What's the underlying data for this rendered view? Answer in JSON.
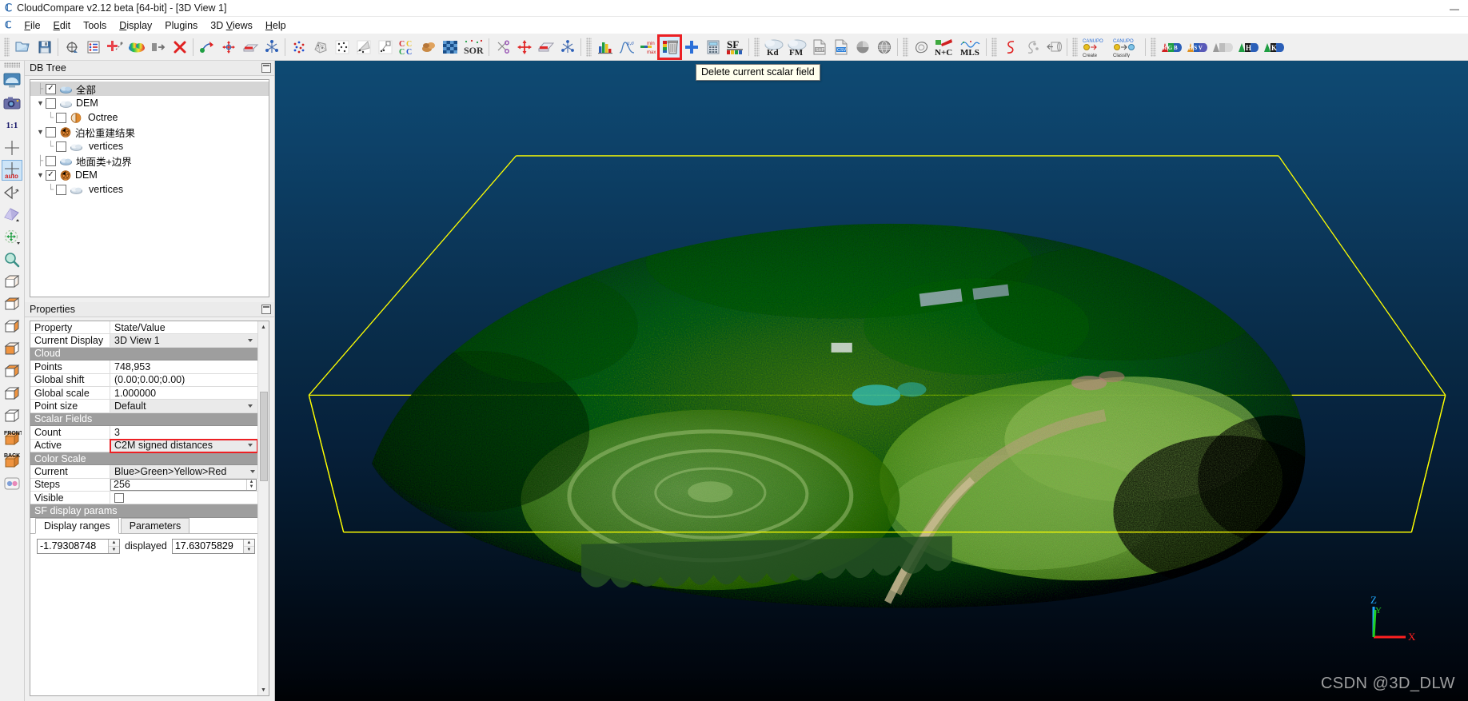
{
  "window": {
    "title": "CloudCompare v2.12 beta [64-bit] - [3D View 1]",
    "app_glyph": "ℂ",
    "minimize": "—",
    "maximize": "❐",
    "close": "✕"
  },
  "menubar": {
    "app_glyph": "ℂ",
    "items": [
      {
        "label": "File",
        "mnemonic": "F"
      },
      {
        "label": "Edit",
        "mnemonic": "E"
      },
      {
        "label": "Tools",
        "mnemonic": ""
      },
      {
        "label": "Display",
        "mnemonic": "D"
      },
      {
        "label": "Plugins",
        "mnemonic": ""
      },
      {
        "label": "3D Views",
        "mnemonic": "V"
      },
      {
        "label": "Help",
        "mnemonic": "H"
      }
    ]
  },
  "toolbar": {
    "tooltip": "Delete current scalar field",
    "highlighted_button": "delete-scalar-field-button",
    "groups": [
      {
        "name": "file-group",
        "buttons": [
          {
            "name": "open-file-button",
            "icon": "open-folder-icon",
            "title": "Open"
          },
          {
            "name": "save-file-button",
            "icon": "save-disk-icon",
            "title": "Save"
          }
        ]
      },
      {
        "name": "edit-group",
        "buttons": [
          {
            "name": "clone-button",
            "icon": "clone-icon",
            "title": "Clone"
          },
          {
            "name": "properties-button",
            "icon": "list-icon",
            "title": "Properties"
          },
          {
            "name": "merge-button",
            "icon": "merge-plus-icon",
            "title": "Merge"
          },
          {
            "name": "colors-button",
            "icon": "rainbow-cloud-icon",
            "title": "Colors"
          },
          {
            "name": "subsample-button",
            "icon": "arrow-into-box-icon",
            "title": "Subsample"
          },
          {
            "name": "delete-button",
            "icon": "red-x-icon",
            "title": "Delete"
          }
        ]
      },
      {
        "name": "transform-group",
        "buttons": [
          {
            "name": "align-button",
            "icon": "align-points-icon",
            "title": "Align"
          },
          {
            "name": "translate-rotate-button",
            "icon": "translate-rotate-icon",
            "title": "Translate/Rotate"
          },
          {
            "name": "segment-button",
            "icon": "segment-icon",
            "title": "Segment"
          }
        ]
      },
      {
        "name": "cloud-tools-group",
        "buttons": [
          {
            "name": "point-picking-button",
            "icon": "point-cloud-icon",
            "title": "Point picking"
          },
          {
            "name": "mesh-button",
            "icon": "mesh-icon",
            "title": "Mesh"
          },
          {
            "name": "sample-points-button",
            "icon": "sample-points-icon",
            "title": "Sample points"
          },
          {
            "name": "normals-button",
            "icon": "normals-icon",
            "title": "Compute normals"
          },
          {
            "name": "fit-button",
            "icon": "fit-plane-icon",
            "title": "Fit"
          },
          {
            "name": "cc-compare-button",
            "icon": "cc-icon",
            "title": "Cloud/Cloud dist"
          },
          {
            "name": "cm-compare-button",
            "icon": "cloud-mesh-icon",
            "title": "Cloud/Mesh dist"
          },
          {
            "name": "checker-button",
            "icon": "checkerboard-icon",
            "title": "Statistical test"
          },
          {
            "name": "sor-filter-button",
            "icon": "sor-icon",
            "title": "SOR filter"
          }
        ]
      },
      {
        "name": "scissors-group",
        "buttons": [
          {
            "name": "scissors-button",
            "icon": "scissors-icon",
            "title": "Cut"
          },
          {
            "name": "translate-gizmo-button",
            "icon": "move-arrows-icon",
            "title": "Translate"
          },
          {
            "name": "section-box-button",
            "icon": "clip-box-icon",
            "title": "Clipping box"
          },
          {
            "name": "registration-button",
            "icon": "registration-icon",
            "title": "Register"
          }
        ]
      },
      {
        "name": "scalar-field-group",
        "buttons": [
          {
            "name": "histogram-button",
            "icon": "bar-chart-icon",
            "title": "Histogram"
          },
          {
            "name": "gaussian-filter-button",
            "icon": "gaussian-curve-icon",
            "title": "Gaussian filter"
          },
          {
            "name": "min-max-button",
            "icon": "min-max-icon",
            "title": "Min/Max"
          },
          {
            "name": "delete-scalar-field-button",
            "icon": "delete-scalar-field-icon",
            "title": "Delete current scalar field"
          },
          {
            "name": "add-scalar-field-button",
            "icon": "blue-plus-icon",
            "title": "Add scalar field"
          },
          {
            "name": "calculator-button",
            "icon": "calculator-icon",
            "title": "SF arithmetic"
          },
          {
            "name": "sf-colors-button",
            "icon": "sf-icon",
            "title": "SF to colors"
          }
        ]
      },
      {
        "name": "interpolation-group",
        "buttons": [
          {
            "name": "kd-tree-button",
            "icon": "kd-cloud-icon",
            "title": "Kd"
          },
          {
            "name": "fm-button",
            "icon": "fm-cloud-icon",
            "title": "FM"
          },
          {
            "name": "shp-export-button",
            "icon": "shp-file-icon",
            "title": "SHP"
          },
          {
            "name": "csv-export-button",
            "icon": "csv-file-icon",
            "title": "CSV"
          },
          {
            "name": "pie-button",
            "icon": "pie-icon",
            "title": "Pie"
          },
          {
            "name": "globe-button",
            "icon": "globe-icon",
            "title": "Globe"
          }
        ]
      },
      {
        "name": "plugins-group",
        "buttons": [
          {
            "name": "poisson-button",
            "icon": "contour-icon",
            "title": "Poisson"
          },
          {
            "name": "nc-button",
            "icon": "n-plus-c-icon",
            "title": "N+C"
          },
          {
            "name": "mls-button",
            "icon": "mls-icon",
            "title": "MLS"
          }
        ]
      },
      {
        "name": "curve-group",
        "buttons": [
          {
            "name": "curve-s-button",
            "icon": "red-s-curve-icon",
            "title": "S"
          },
          {
            "name": "scatter-curve-button",
            "icon": "scatter-curve-icon",
            "title": "Scatter"
          },
          {
            "name": "extrude-button",
            "icon": "extrude-icon",
            "title": "Extrude"
          }
        ]
      },
      {
        "name": "canupo-group",
        "buttons": [
          {
            "name": "canupo-create-button",
            "icon": "canupo-create-icon",
            "title": "CANUPO Create"
          },
          {
            "name": "canupo-classify-button",
            "icon": "canupo-classify-icon",
            "title": "CANUPO Classify"
          }
        ]
      },
      {
        "name": "color-convert-group",
        "buttons": [
          {
            "name": "rgb-convert-button",
            "icon": "rgb-icon",
            "title": "RGB"
          },
          {
            "name": "hsv-convert-button",
            "icon": "hsv-icon",
            "title": "HSV"
          },
          {
            "name": "gray-convert-button",
            "icon": "gray-icon",
            "title": "Gray"
          },
          {
            "name": "h-convert-button",
            "icon": "h-icon",
            "title": "H"
          },
          {
            "name": "k-convert-button",
            "icon": "k-icon",
            "title": "K"
          }
        ]
      }
    ]
  },
  "left_toolbar": {
    "buttons": [
      {
        "name": "fullscreen-view-button",
        "icon": "monitor-icon",
        "active": false
      },
      {
        "name": "snapshot-button",
        "icon": "camera-icon",
        "active": false
      },
      {
        "name": "zoom-one-to-one-button",
        "icon": "one-to-one-icon",
        "label": "1:1",
        "active": false
      },
      {
        "name": "set-pivot-button",
        "icon": "crosshair-icon",
        "active": false
      },
      {
        "name": "auto-pivot-button",
        "icon": "crosshair-auto-icon",
        "label": "auto",
        "active": true
      },
      {
        "name": "toggle-perspective-button",
        "icon": "eye-perspective-icon",
        "active": false
      },
      {
        "name": "viewer-perspective-button",
        "icon": "plane-perspective-icon",
        "active": false
      },
      {
        "name": "object-rotate-button",
        "icon": "rotate-object-icon",
        "active": false
      },
      {
        "name": "zoom-tool-button",
        "icon": "magnifier-icon",
        "active": false
      },
      {
        "name": "global-zoom-button",
        "icon": "cube-wire-icon",
        "active": false
      },
      {
        "name": "top-view-button",
        "icon": "cube-top-icon",
        "active": false
      },
      {
        "name": "bottom-view-button",
        "icon": "cube-bottom-icon",
        "active": false
      },
      {
        "name": "left-view-button",
        "icon": "cube-left-icon",
        "active": false
      },
      {
        "name": "right-view-button",
        "icon": "cube-right-icon",
        "active": false
      },
      {
        "name": "iso1-view-button",
        "icon": "cube-iso1-icon",
        "active": false
      },
      {
        "name": "iso2-view-button",
        "icon": "cube-iso2-icon",
        "active": false
      },
      {
        "name": "front-view-button",
        "icon": "cube-front-icon",
        "label": "FRONT",
        "active": false
      },
      {
        "name": "back-view-button",
        "icon": "cube-back-icon",
        "label": "BACK",
        "active": false
      },
      {
        "name": "stereo-mode-button",
        "icon": "two-dots-icon",
        "active": false
      }
    ]
  },
  "db_tree": {
    "title": "DB Tree",
    "items": [
      {
        "label": "全部",
        "depth": 0,
        "arrow": "",
        "elbow": "├",
        "checked": true,
        "icon": "cloud-icon",
        "selected": true
      },
      {
        "label": "DEM",
        "depth": 0,
        "arrow": "▼",
        "elbow": "",
        "checked": false,
        "icon": "cloud-icon",
        "selected": false
      },
      {
        "label": "Octree",
        "depth": 1,
        "arrow": "",
        "elbow": "└",
        "checked": false,
        "icon": "octree-icon",
        "selected": false
      },
      {
        "label": "泊松重建结果",
        "depth": 0,
        "arrow": "▼",
        "elbow": "",
        "checked": false,
        "icon": "mesh-star-icon",
        "selected": false
      },
      {
        "label": "vertices",
        "depth": 1,
        "arrow": "",
        "elbow": "└",
        "checked": false,
        "icon": "cloud-icon",
        "selected": false
      },
      {
        "label": "地面类+边界",
        "depth": 0,
        "arrow": "",
        "elbow": "├",
        "checked": false,
        "icon": "cloud-icon",
        "selected": false
      },
      {
        "label": "DEM",
        "depth": 0,
        "arrow": "▼",
        "elbow": "",
        "checked": true,
        "icon": "mesh-star-icon",
        "selected": false
      },
      {
        "label": "vertices",
        "depth": 1,
        "arrow": "",
        "elbow": "└",
        "checked": false,
        "icon": "cloud-icon",
        "selected": false
      }
    ]
  },
  "properties": {
    "title": "Properties",
    "header": {
      "property": "Property",
      "state_value": "State/Value"
    },
    "rows": [
      {
        "key": "Current Display",
        "value": "3D View 1",
        "kind": "combo"
      },
      {
        "section": "Cloud"
      },
      {
        "key": "Points",
        "value": "748,953",
        "kind": "text"
      },
      {
        "key": "Global shift",
        "value": "(0.00;0.00;0.00)",
        "kind": "text"
      },
      {
        "key": "Global scale",
        "value": "1.000000",
        "kind": "text"
      },
      {
        "key": "Point size",
        "value": "Default",
        "kind": "combo"
      },
      {
        "section": "Scalar Fields"
      },
      {
        "key": "Count",
        "value": "3",
        "kind": "text"
      },
      {
        "key": "Active",
        "value": "C2M signed distances",
        "kind": "combo",
        "highlight": true
      },
      {
        "section": "Color Scale"
      },
      {
        "key": "Current",
        "value": "Blue>Green>Yellow>Red",
        "kind": "combo-ramp"
      },
      {
        "key": "Steps",
        "value": "256",
        "kind": "spin"
      },
      {
        "key": "Visible",
        "value": "",
        "kind": "checkbox",
        "checked": false
      },
      {
        "section": "SF display params"
      }
    ],
    "sf_tabs": [
      {
        "label": "Display ranges",
        "active": true
      },
      {
        "label": "Parameters",
        "active": false
      }
    ],
    "display_range": {
      "min": "-1.79308748",
      "label": "displayed",
      "max": "17.63075829"
    }
  },
  "view3d": {
    "watermark": "CSDN @3D_DLW",
    "axis": {
      "x": "X",
      "y": "Y",
      "z": "Z",
      "x_color": "#ff2020",
      "y_color": "#20d020",
      "z_color": "#20a8ff"
    },
    "bbox_color": "#ffff00",
    "background_top": "#0e4a73",
    "background_bottom": "#000205"
  }
}
